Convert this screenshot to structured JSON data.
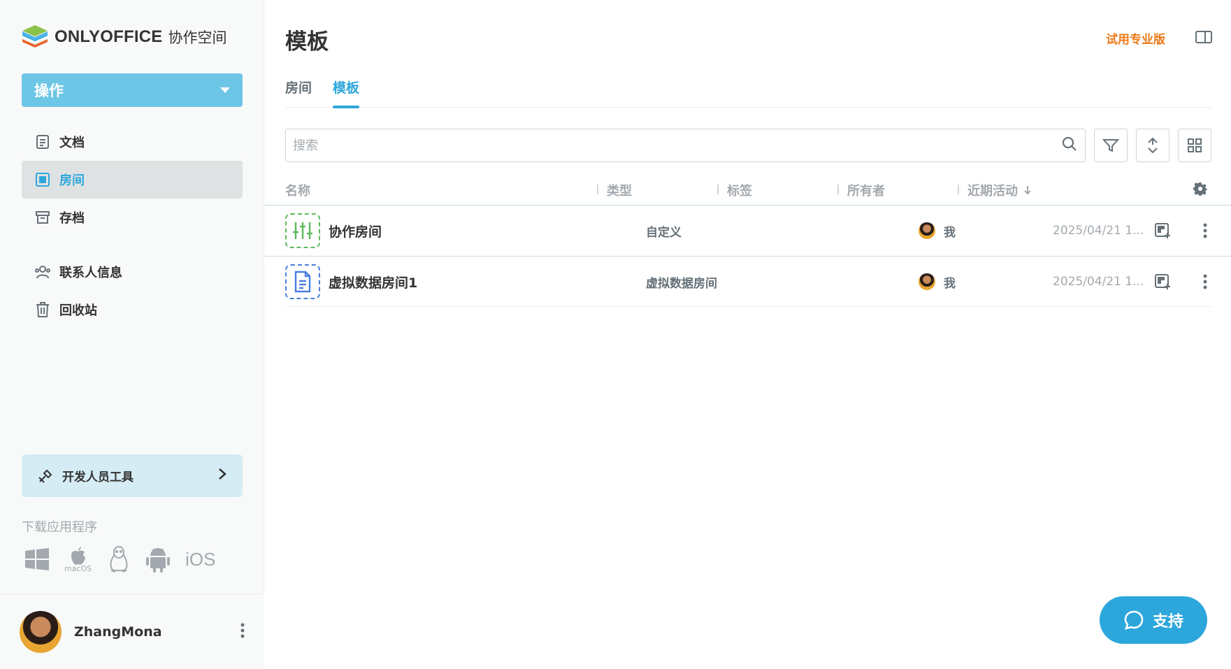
{
  "brand": {
    "name": "ONLYOFFICE",
    "subtitle": "协作空间"
  },
  "sidebar": {
    "actions_label": "操作",
    "nav": [
      {
        "label": "文档",
        "icon": "document-icon"
      },
      {
        "label": "房间",
        "icon": "rooms-icon",
        "active": true
      },
      {
        "label": "存档",
        "icon": "archive-icon"
      },
      {
        "label": "联系人信息",
        "icon": "contacts-icon"
      },
      {
        "label": "回收站",
        "icon": "trash-icon"
      }
    ],
    "dev_tools_label": "开发人员工具",
    "download_title": "下载应用程序",
    "platforms": [
      "windows-icon",
      "macos-icon",
      "linux-icon",
      "android-icon",
      "ios-icon"
    ],
    "macos_label": "macOS",
    "ios_label": "iOS"
  },
  "profile": {
    "name": "ZhangMona"
  },
  "header": {
    "title": "模板",
    "pro_link": "试用专业版"
  },
  "tabs": [
    {
      "label": "房间"
    },
    {
      "label": "模板",
      "active": true
    }
  ],
  "search": {
    "placeholder": "搜索"
  },
  "table": {
    "columns": [
      "名称",
      "类型",
      "标签",
      "所有者",
      "近期活动"
    ],
    "rows": [
      {
        "name": "协作房间",
        "type": "自定义",
        "owner": "我",
        "date": "2025/04/21 1...",
        "icon": "custom-room-icon",
        "color": "#5cb85c"
      },
      {
        "name": "虚拟数据房间1",
        "type": "虚拟数据房间",
        "owner": "我",
        "date": "2025/04/21 1...",
        "icon": "vdr-room-icon",
        "color": "#4a7ee0"
      }
    ]
  },
  "support": {
    "label": "支持"
  },
  "colors": {
    "accent": "#2da7db",
    "pro": "#ec7a19",
    "actions": "#6ec6e6"
  }
}
